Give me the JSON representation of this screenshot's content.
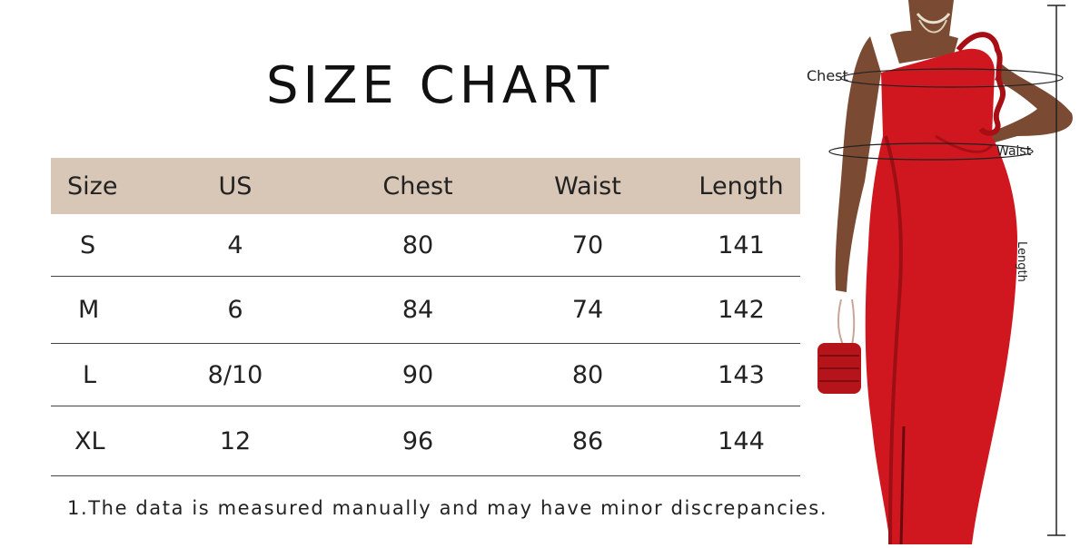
{
  "title": "SIZE CHART",
  "table": {
    "columns": [
      "Size",
      "US",
      "Chest",
      "Waist",
      "Length"
    ],
    "rows": [
      [
        "S",
        "4",
        "80",
        "70",
        "141"
      ],
      [
        "M",
        "6",
        "84",
        "74",
        "142"
      ],
      [
        "L",
        "8/10",
        "90",
        "80",
        "143"
      ],
      [
        "XL",
        "12",
        "96",
        "86",
        "144"
      ]
    ]
  },
  "note": "1.The data is measured manually and may have minor discrepancies.",
  "figure": {
    "labels": {
      "chest": "Chest",
      "waist": "Waist",
      "length": "Length"
    },
    "icons": [
      "dress-figure-icon",
      "handbag-icon"
    ],
    "colors": {
      "header_bg": "#d8c6b7",
      "dress": "#d0171f",
      "skin": "#7a4a33"
    }
  }
}
